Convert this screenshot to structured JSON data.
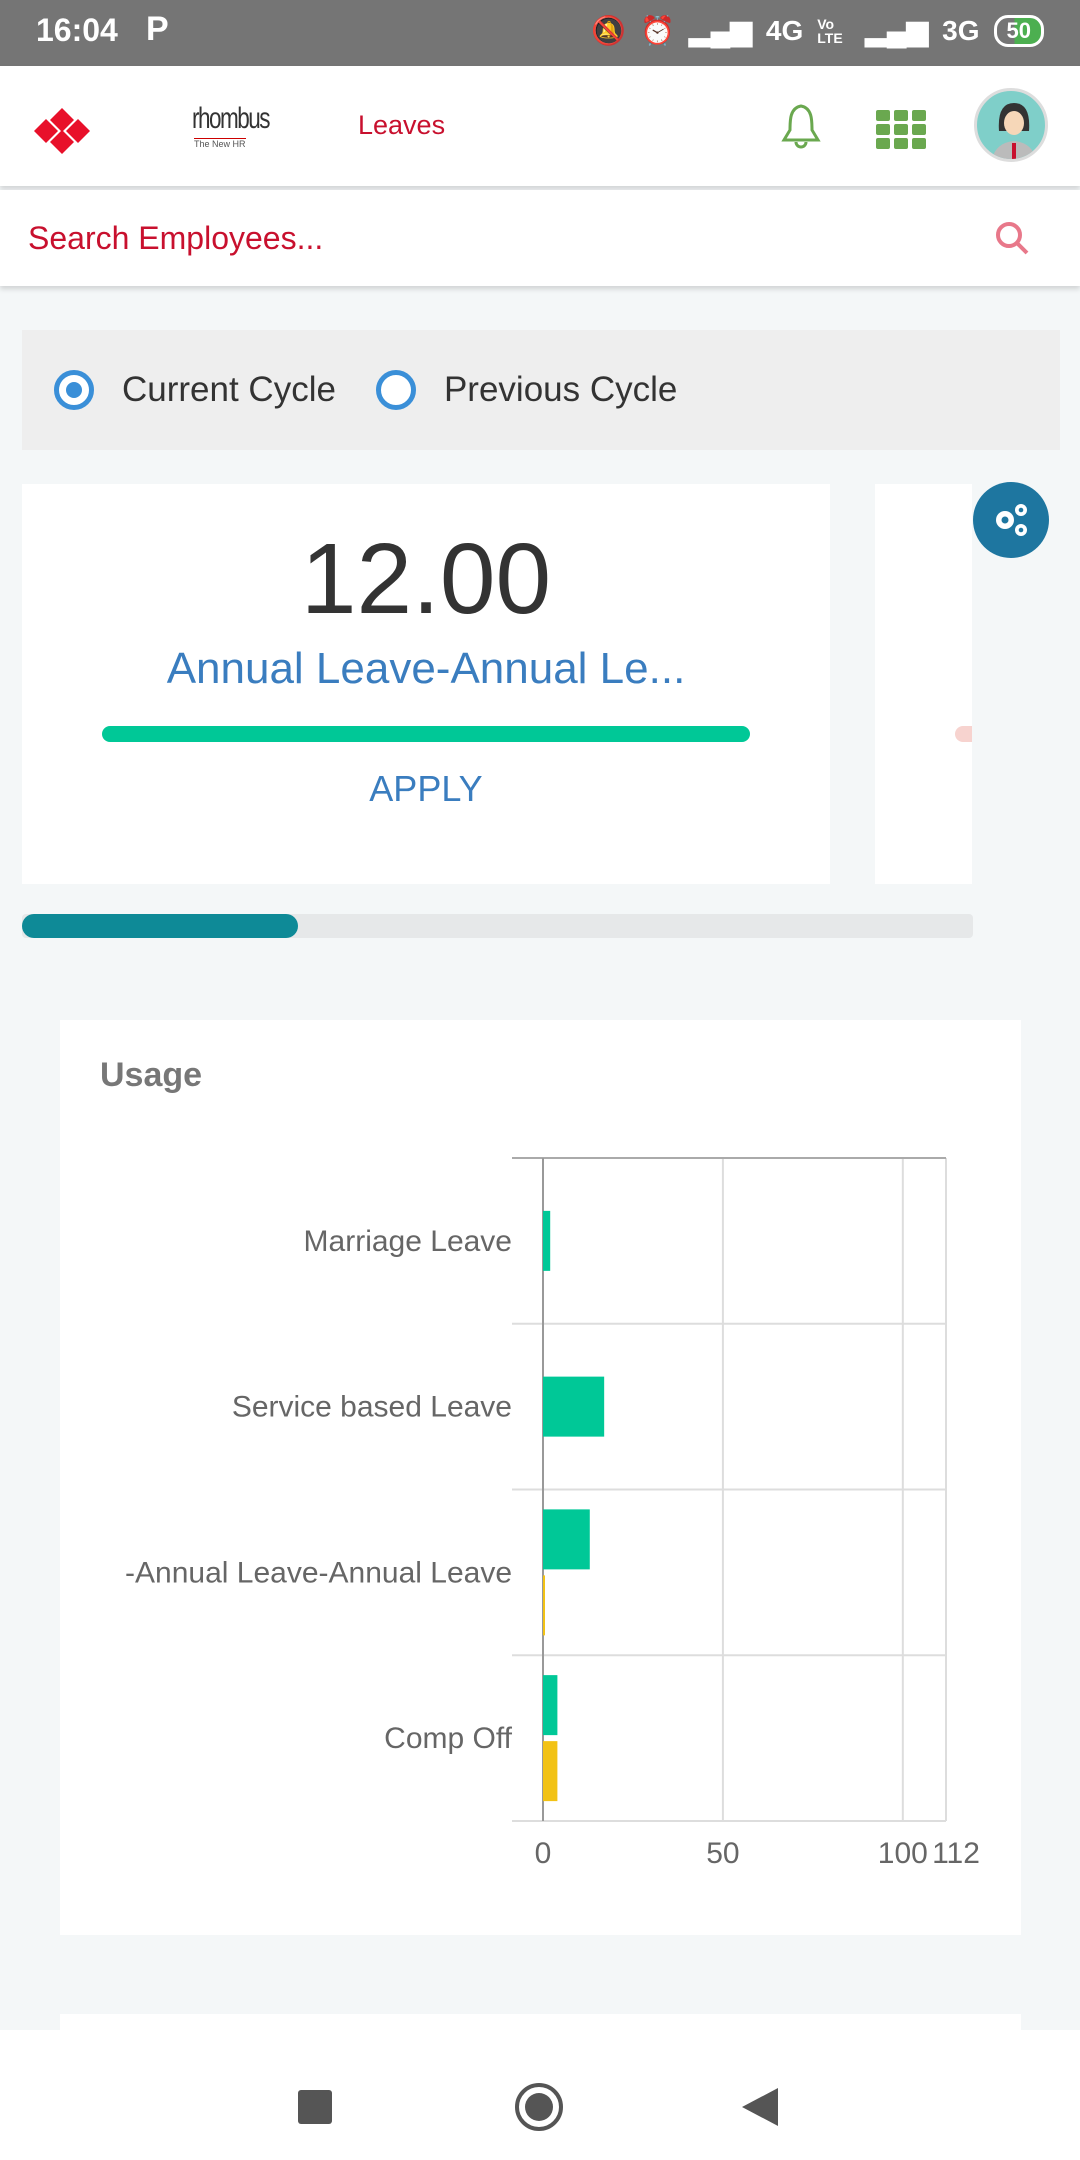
{
  "status_bar": {
    "time": "16:04",
    "notification": "P",
    "network1": "4G",
    "volte": "Vo LTE",
    "network2": "3G",
    "battery": "50"
  },
  "header": {
    "brand": "rhombus",
    "brand_tagline": "The New HR",
    "title": "Leaves",
    "accent": "#c8102e"
  },
  "search": {
    "placeholder": "Search Employees..."
  },
  "cycle": {
    "options": [
      {
        "label": "Current Cycle",
        "selected": true
      },
      {
        "label": "Previous Cycle",
        "selected": false
      }
    ]
  },
  "leave_card": {
    "balance": "12.00",
    "type": "Annual Leave-Annual Le...",
    "apply_label": "APPLY",
    "progress": 1.0
  },
  "carousel": {
    "scroll_fraction": 0.29
  },
  "usage": {
    "title": "Usage"
  },
  "chart_data": {
    "type": "bar",
    "orientation": "horizontal",
    "categories": [
      "Marriage Leave",
      "Service based Leave",
      "-Annual Leave-Annual Leave",
      "Comp Off"
    ],
    "series": [
      {
        "values": [
          2,
          17,
          13,
          4
        ],
        "color": "#00c897"
      },
      {
        "values": [
          0,
          0,
          0.5,
          4
        ],
        "color": "#f2c215"
      }
    ],
    "xlim": [
      0,
      112
    ],
    "xticks": [
      "0",
      "50",
      "100",
      "112"
    ],
    "grid": true
  }
}
